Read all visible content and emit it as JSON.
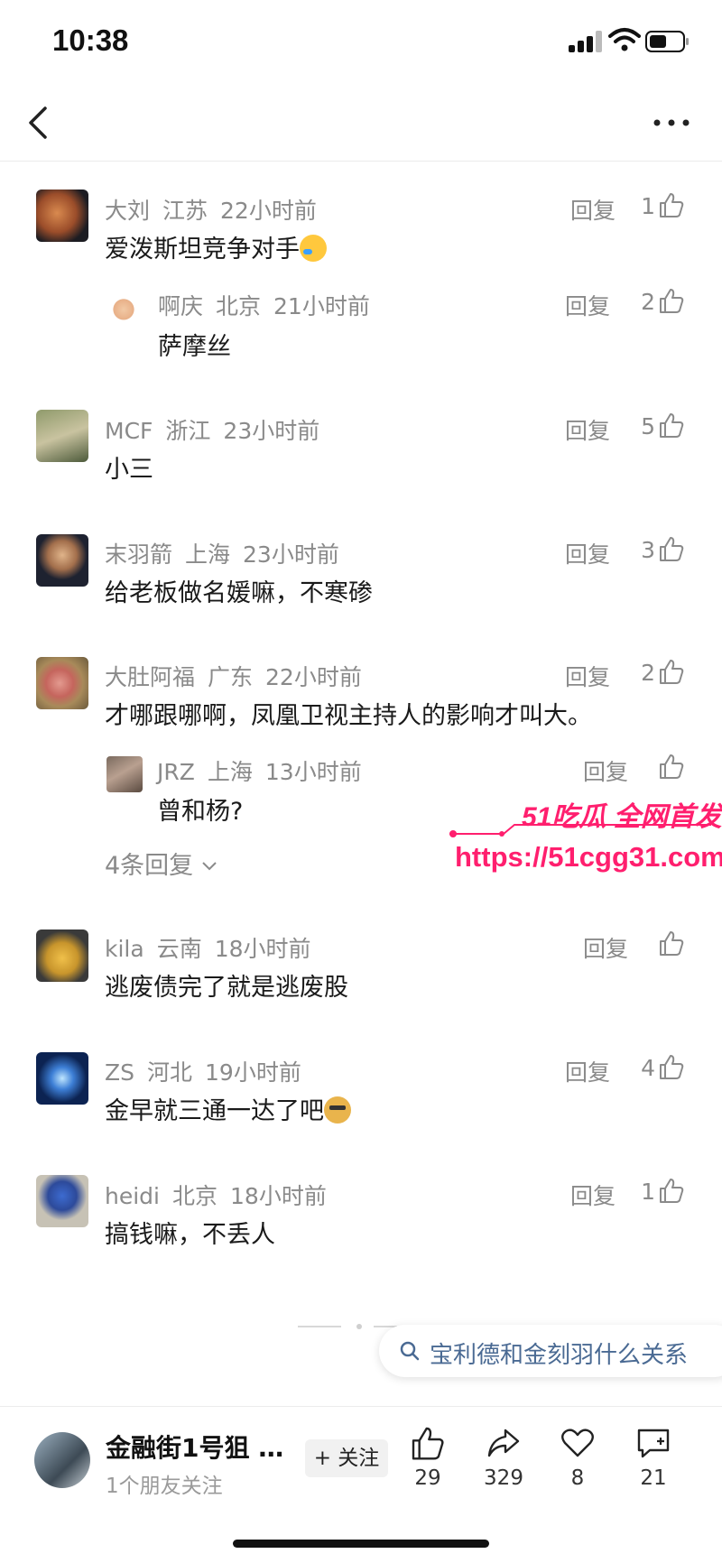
{
  "status_bar": {
    "time": "10:38"
  },
  "reply_label": "回复",
  "comments": [
    {
      "user": "大刘",
      "region": "江苏",
      "time": "22小时前",
      "text": "爱泼斯坦竞争对手",
      "likes": "1",
      "emoji": "cry-laugh"
    },
    {
      "user": "啊庆",
      "region": "北京",
      "time": "21小时前",
      "text": "萨摩丝",
      "likes": "2"
    },
    {
      "user": "MCF",
      "region": "浙江",
      "time": "23小时前",
      "text": "小三",
      "likes": "5"
    },
    {
      "user": "末羽箭",
      "region": "上海",
      "time": "23小时前",
      "text": "给老板做名媛嘛，不寒碜",
      "likes": "3"
    },
    {
      "user": "大肚阿福",
      "region": "广东",
      "time": "22小时前",
      "text": "才哪跟哪啊，凤凰卫视主持人的影响才叫大。",
      "likes": "2"
    },
    {
      "user": "JRZ",
      "region": "上海",
      "time": "13小时前",
      "text": "曾和杨?",
      "likes": ""
    },
    {
      "user": "kila",
      "region": "云南",
      "time": "18小时前",
      "text": "逃废债完了就是逃废股",
      "likes": ""
    },
    {
      "user": "ZS",
      "region": "河北",
      "time": "19小时前",
      "text": "金早就三通一达了吧",
      "likes": "4",
      "emoji": "doge"
    },
    {
      "user": "heidi",
      "region": "北京",
      "time": "18小时前",
      "text": "搞钱嘛，不丢人",
      "likes": "1"
    }
  ],
  "more_replies": "4条回复",
  "watermark": {
    "title": "51吃瓜 全网首发",
    "url": "https://51cgg31.com"
  },
  "search_suggestion": "宝利德和金刻羽什么关系",
  "bottom_bar": {
    "author_name": "金融街1号狙 …",
    "author_sub": "1个朋友关注",
    "follow_label": "+ 关注",
    "likes": "29",
    "shares": "329",
    "favorites": "8",
    "comments": "21"
  },
  "colors": {
    "watermark": "#ff1f6e",
    "meta": "#8a8a8a",
    "search_text": "#4a6a93"
  }
}
